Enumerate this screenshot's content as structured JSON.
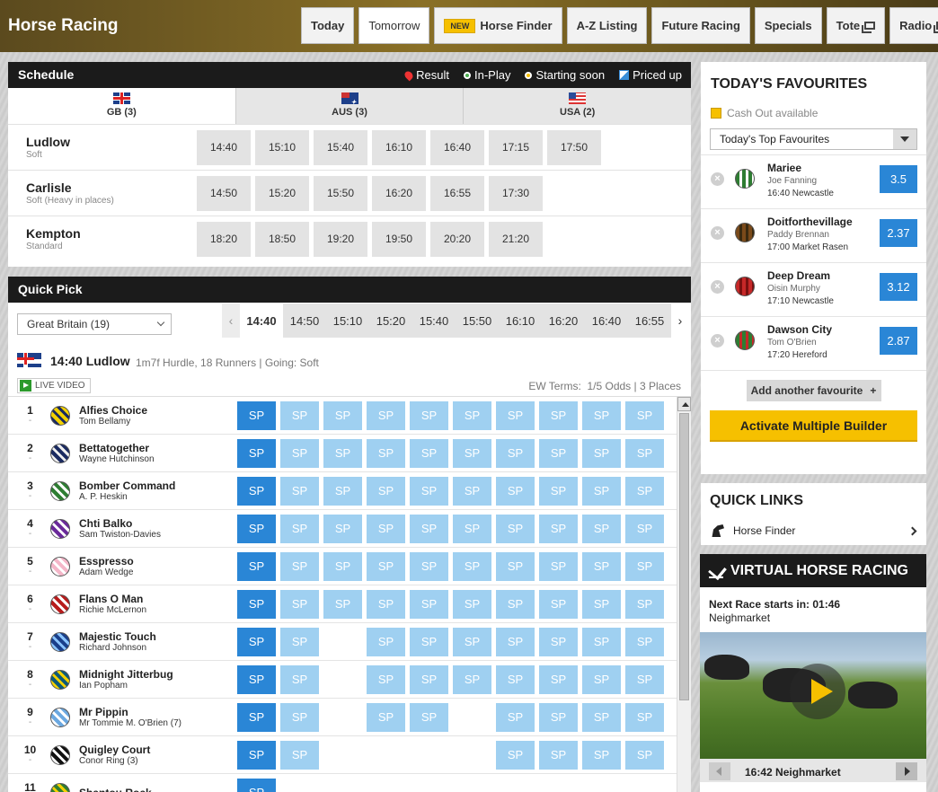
{
  "header": {
    "title": "Horse Racing",
    "nav": [
      {
        "label": "Today",
        "active": false
      },
      {
        "label": "Tomorrow",
        "active": true
      },
      {
        "label": "Horse Finder",
        "badge": "NEW"
      },
      {
        "label": "A-Z Listing"
      },
      {
        "label": "Future Racing"
      },
      {
        "label": "Specials"
      },
      {
        "label": "Tote",
        "external": true
      },
      {
        "label": "Radio",
        "external": true
      }
    ]
  },
  "schedule": {
    "title": "Schedule",
    "legend": [
      "Result",
      "In-Play",
      "Starting soon",
      "Priced up"
    ],
    "legend_colors": {
      "result": "#e33333",
      "in_play": "#4caf50",
      "starting_soon": "#f6c000",
      "priced_up": "#3b8fd9"
    },
    "tabs": [
      "GB (3)",
      "AUS (3)",
      "USA (2)"
    ],
    "meetings": [
      {
        "name": "Ludlow",
        "going": "Soft",
        "times": [
          "14:40",
          "15:10",
          "15:40",
          "16:10",
          "16:40",
          "17:15",
          "17:50"
        ]
      },
      {
        "name": "Carlisle",
        "going": "Soft (Heavy in places)",
        "times": [
          "14:50",
          "15:20",
          "15:50",
          "16:20",
          "16:55",
          "17:30"
        ]
      },
      {
        "name": "Kempton",
        "going": "Standard",
        "times": [
          "18:20",
          "18:50",
          "19:20",
          "19:50",
          "20:20",
          "21:20"
        ]
      }
    ]
  },
  "quick_pick": {
    "title": "Quick Pick",
    "region_select": "Great Britain (19)",
    "times": [
      "14:40",
      "14:50",
      "15:10",
      "15:20",
      "15:40",
      "15:50",
      "16:10",
      "16:20",
      "16:40",
      "16:55"
    ],
    "prev_arrow": "‹",
    "next_arrow": "›",
    "race_title": "14:40 Ludlow",
    "race_info": "1m7f Hurdle, 18 Runners | Going: Soft",
    "live_video": "LIVE VIDEO",
    "ew_terms_label": "EW Terms:",
    "ew_terms_value": "1/5 Odds | 3 Places",
    "sp_label": "SP",
    "runners": [
      {
        "no": "1",
        "sub": "-",
        "horse": "Alfies Choice",
        "jockey": "Tom Bellamy",
        "silk": [
          "#f2d000",
          "#1a2a60"
        ],
        "sp": [
          1,
          1,
          1,
          1,
          1,
          1,
          1,
          1,
          1,
          1
        ]
      },
      {
        "no": "2",
        "sub": "-",
        "horse": "Bettatogether",
        "jockey": "Wayne Hutchinson",
        "silk": [
          "#1a2a60",
          "#eeeeee"
        ],
        "sp": [
          1,
          1,
          1,
          1,
          1,
          1,
          1,
          1,
          1,
          1
        ]
      },
      {
        "no": "3",
        "sub": "-",
        "horse": "Bomber Command",
        "jockey": "A. P. Heskin",
        "silk": [
          "#2e7d32",
          "#ffffff"
        ],
        "sp": [
          1,
          1,
          1,
          1,
          1,
          1,
          1,
          1,
          1,
          1
        ]
      },
      {
        "no": "4",
        "sub": "-",
        "horse": "Chti Balko",
        "jockey": "Sam Twiston-Davies",
        "silk": [
          "#6a2a9a",
          "#ffffff"
        ],
        "sp": [
          1,
          1,
          1,
          1,
          1,
          1,
          1,
          1,
          1,
          1
        ]
      },
      {
        "no": "5",
        "sub": "-",
        "horse": "Esspresso",
        "jockey": "Adam Wedge",
        "silk": [
          "#f4b6c8",
          "#ffffff"
        ],
        "sp": [
          1,
          1,
          1,
          1,
          1,
          1,
          1,
          1,
          1,
          1
        ]
      },
      {
        "no": "6",
        "sub": "-",
        "horse": "Flans O Man",
        "jockey": "Richie McLernon",
        "silk": [
          "#b71c1c",
          "#ffffff"
        ],
        "sp": [
          1,
          1,
          1,
          1,
          1,
          1,
          1,
          1,
          1,
          1
        ]
      },
      {
        "no": "7",
        "sub": "-",
        "horse": "Majestic Touch",
        "jockey": "Richard Johnson",
        "silk": [
          "#1a3f8a",
          "#8ac4ff"
        ],
        "sp": [
          1,
          1,
          0,
          1,
          1,
          1,
          1,
          1,
          1,
          1
        ]
      },
      {
        "no": "8",
        "sub": "-",
        "horse": "Midnight Jitterbug",
        "jockey": "Ian Popham",
        "silk": [
          "#0d5a7a",
          "#f2d000"
        ],
        "sp": [
          1,
          1,
          0,
          1,
          1,
          1,
          1,
          1,
          1,
          1
        ]
      },
      {
        "no": "9",
        "sub": "-",
        "horse": "Mr Pippin",
        "jockey": "Mr Tommie M. O'Brien (7)",
        "silk": [
          "#6ba8e0",
          "#ffffff"
        ],
        "sp": [
          1,
          1,
          0,
          1,
          1,
          0,
          1,
          1,
          1,
          1
        ]
      },
      {
        "no": "10",
        "sub": "-",
        "horse": "Quigley Court",
        "jockey": "Conor Ring (3)",
        "silk": [
          "#111111",
          "#ffffff"
        ],
        "sp": [
          1,
          1,
          0,
          0,
          0,
          0,
          1,
          1,
          1,
          1
        ]
      },
      {
        "no": "11",
        "sub": "-",
        "horse": "Shantou Rock",
        "jockey": "",
        "silk": [
          "#2e7d32",
          "#f2d000"
        ],
        "sp": [
          1,
          0,
          0,
          0,
          0,
          0,
          0,
          0,
          0,
          0
        ]
      }
    ]
  },
  "favourites": {
    "title": "TODAY'S FAVOURITES",
    "cash_out": "Cash Out available",
    "select": "Today's Top Favourites",
    "items": [
      {
        "horse": "Mariee",
        "jockey": "Joe Fanning",
        "race": "16:40 Newcastle",
        "odds": "3.5",
        "silk": [
          "#2e7d32",
          "#ffffff"
        ]
      },
      {
        "horse": "Doitforthevillage",
        "jockey": "Paddy Brennan",
        "race": "17:00 Market Rasen",
        "odds": "2.37",
        "silk": [
          "#7a4a1a",
          "#3a2a10"
        ]
      },
      {
        "horse": "Deep Dream",
        "jockey": "Oisin Murphy",
        "race": "17:10 Newcastle",
        "odds": "3.12",
        "silk": [
          "#c62828",
          "#7a1010"
        ]
      },
      {
        "horse": "Dawson City",
        "jockey": "Tom O'Brien",
        "race": "17:20 Hereford",
        "odds": "2.87",
        "silk": [
          "#2e7d32",
          "#c62828"
        ]
      }
    ],
    "add_label": "Add another favourite",
    "add_plus": "+",
    "activate_label": "Activate Multiple Builder"
  },
  "quick_links": {
    "title": "QUICK LINKS",
    "items": [
      {
        "label": "Horse Finder"
      }
    ]
  },
  "virtual": {
    "title": "VIRTUAL HORSE RACING",
    "next_race": "Next Race starts in: 01:46",
    "venue": "Neighmarket",
    "nav_label": "16:42 Neighmarket"
  },
  "colors": {
    "accent_yellow": "#f6c000",
    "bet_blue": "#2a86d6",
    "bet_blue_light": "#9fd0f1",
    "dark": "#1b1b1b"
  }
}
